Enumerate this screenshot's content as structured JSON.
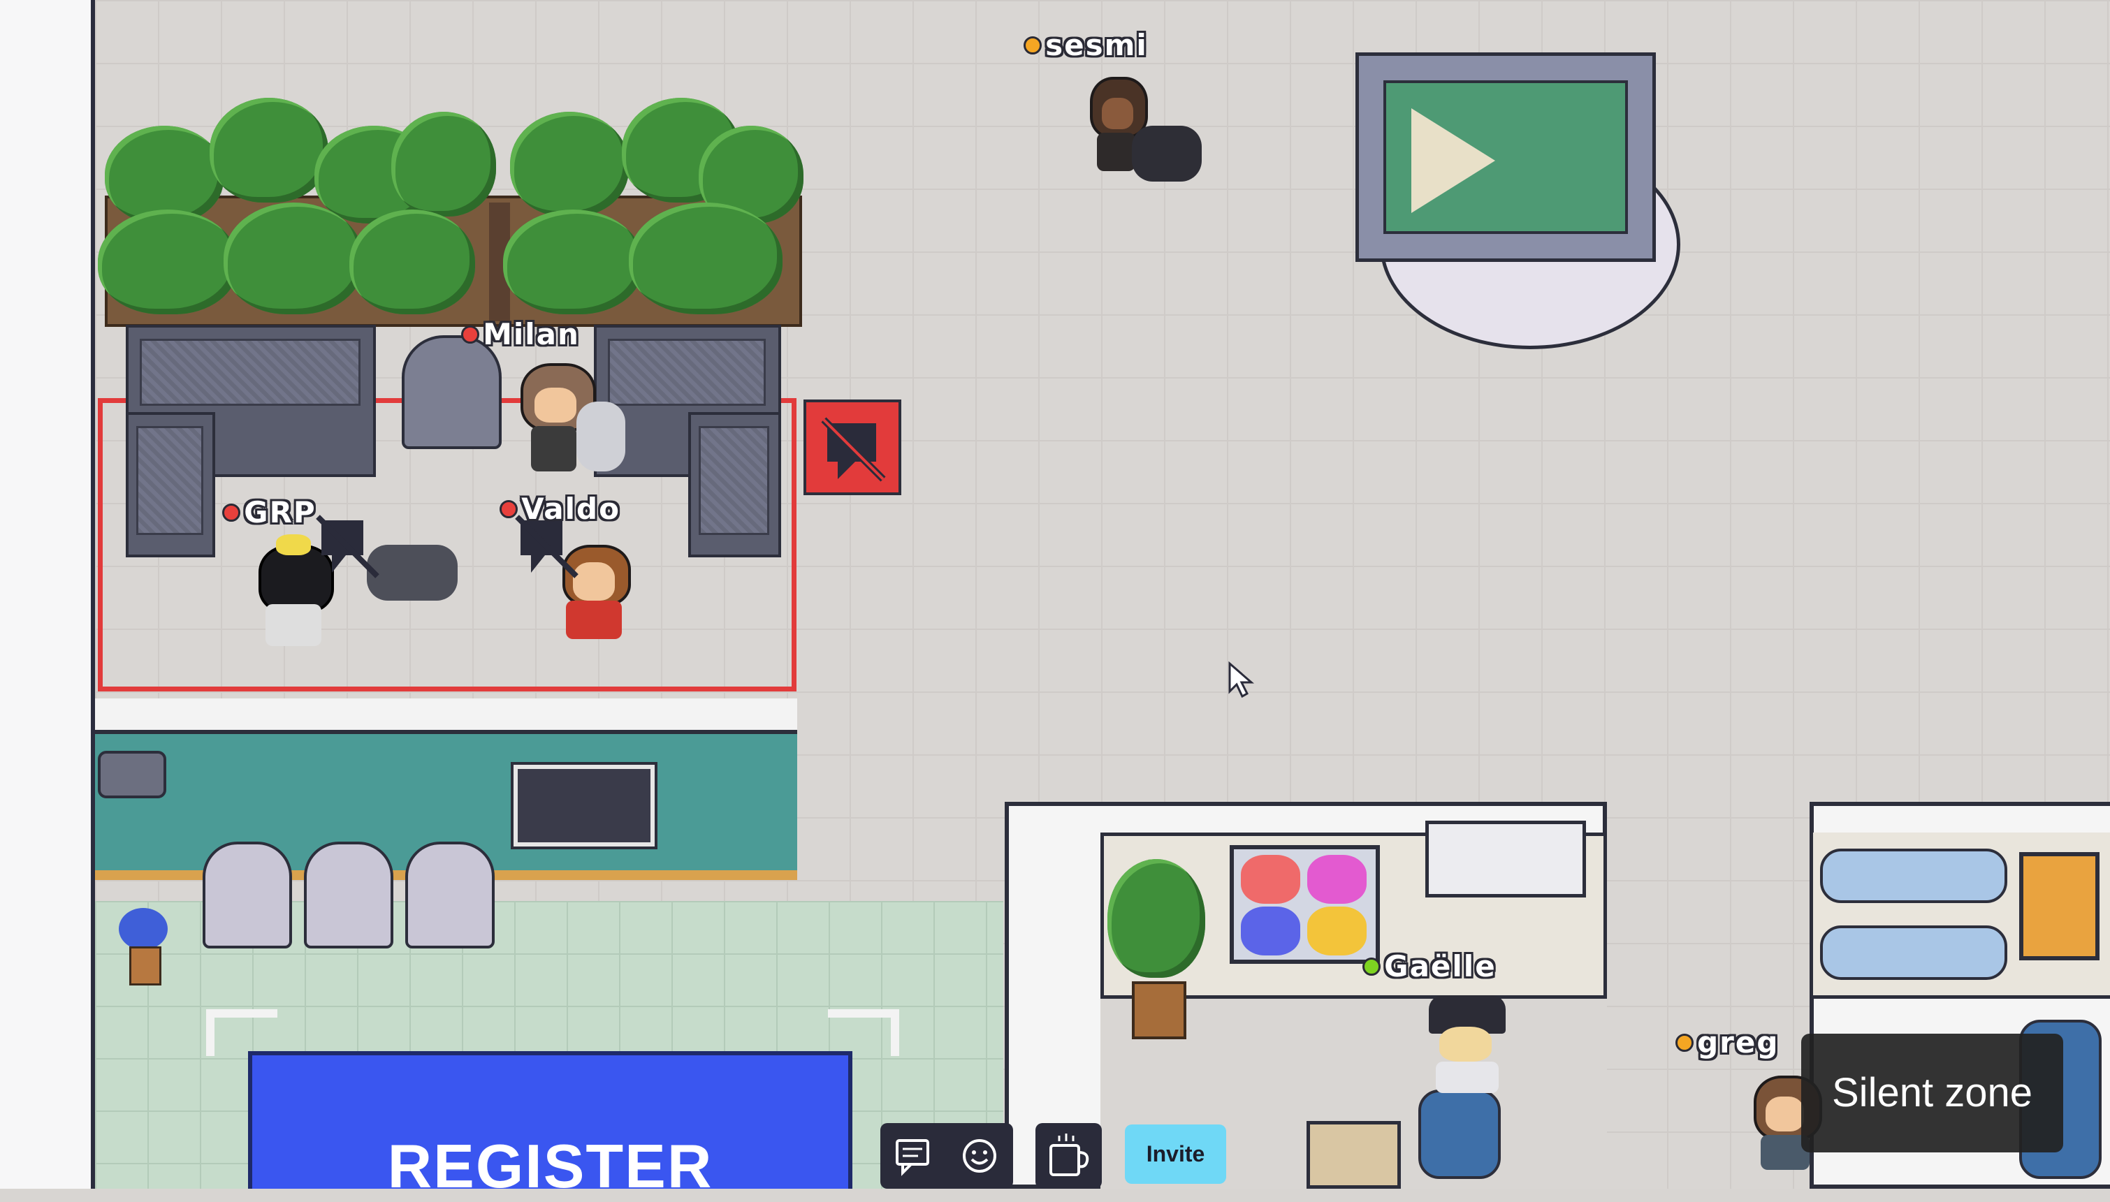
{
  "players": [
    {
      "name": "sesmi",
      "status_color": "#f5a623"
    },
    {
      "name": "Milan",
      "status_color": "#e8403c"
    },
    {
      "name": "GRP",
      "status_color": "#e8403c"
    },
    {
      "name": "Valdo",
      "status_color": "#e8403c"
    },
    {
      "name": "Gaëlle",
      "status_color": "#7ed321"
    },
    {
      "name": "greg",
      "status_color": "#f5a623"
    }
  ],
  "register_sign": "REGISTER",
  "silent_zone_label": "Silent zone",
  "toolbar": {
    "chat_icon": "chat-icon",
    "emote_icon": "smiley-icon",
    "away_icon": "coffee-cup-icon",
    "invite_label": "Invite"
  },
  "colors": {
    "private_area_border": "#e23b3b",
    "register_blue": "#3a56f0",
    "invite_bg": "#6fd8f6",
    "toast_bg": "#2a2a2a"
  }
}
